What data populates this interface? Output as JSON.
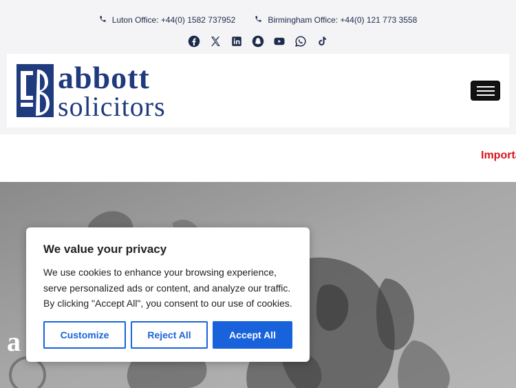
{
  "topbar": {
    "contacts": [
      {
        "label": "Luton Office: +44(0) 1582 737952",
        "icon": "phone-icon"
      },
      {
        "label": "Birmingham Office: +44(0) 121 773 3558",
        "icon": "phone-icon"
      }
    ],
    "socials": [
      "facebook-icon",
      "x-icon",
      "linkedin-icon",
      "snapchat-icon",
      "youtube-icon",
      "whatsapp-icon",
      "tiktok-icon"
    ]
  },
  "header": {
    "logo_line1": "abbott",
    "logo_line2": "solicitors",
    "menu_icon": "hamburger-icon"
  },
  "ticker": {
    "text": "Importa"
  },
  "hero": {
    "letter": "a"
  },
  "cookie_banner": {
    "title": "We value your privacy",
    "body": "We use cookies to enhance your browsing experience, serve personalized ads or content, and analyze our traffic. By clicking \"Accept All\", you consent to our use of cookies.",
    "customize_label": "Customize",
    "reject_label": "Reject All",
    "accept_label": "Accept All"
  },
  "colors": {
    "brand_navy": "#1f3a7d",
    "accent_blue": "#1863dc",
    "ticker_red": "#d8141b"
  }
}
